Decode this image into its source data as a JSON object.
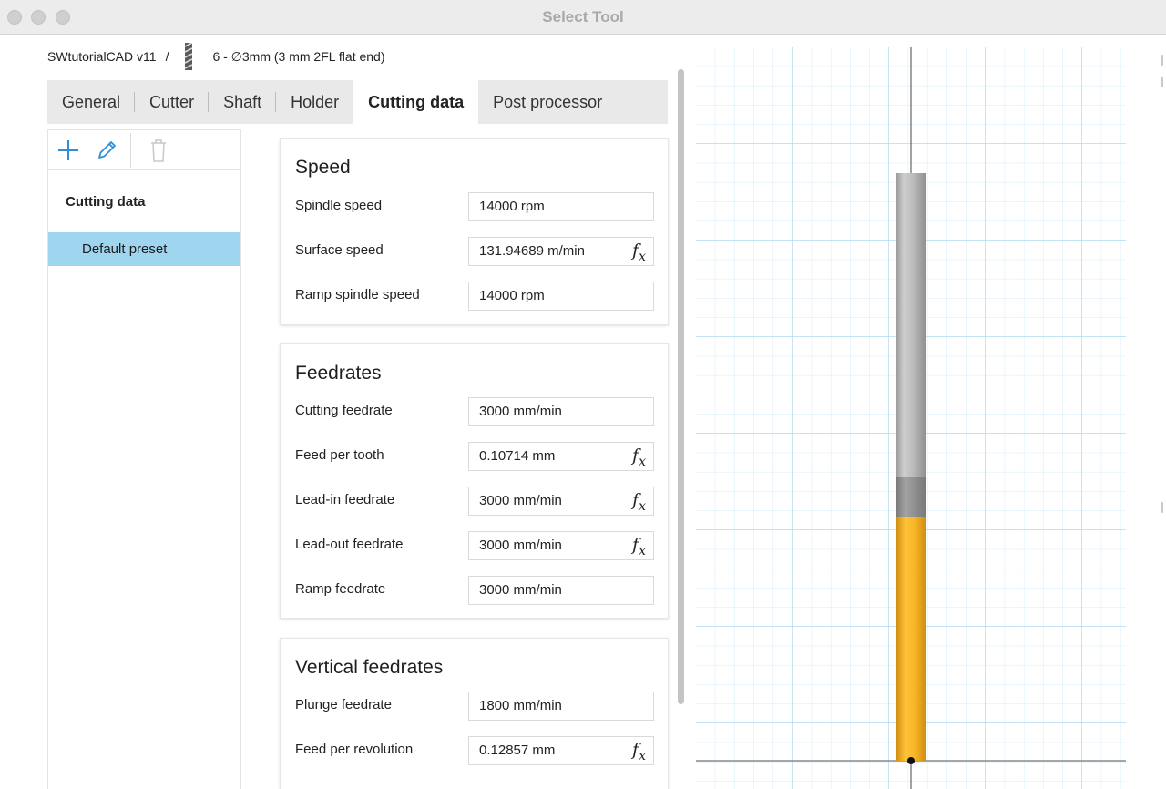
{
  "window": {
    "title": "Select Tool"
  },
  "breadcrumb": {
    "project": "SWtutorialCAD v11",
    "separator": "/",
    "tool": "6 - ∅3mm (3 mm 2FL flat end)"
  },
  "tabs": [
    "General",
    "Cutter",
    "Shaft",
    "Holder",
    "Cutting data",
    "Post processor"
  ],
  "active_tab": "Cutting data",
  "left_panel": {
    "tools": [
      "add-icon",
      "edit-icon",
      "trash-icon"
    ],
    "heading": "Cutting data",
    "items": [
      "Default preset"
    ]
  },
  "sections": {
    "speed": {
      "title": "Speed",
      "fields": [
        {
          "label": "Spindle speed",
          "value": "14000 rpm",
          "fx": false
        },
        {
          "label": "Surface speed",
          "value": "131.94689 m/min",
          "fx": true
        },
        {
          "label": "Ramp spindle speed",
          "value": "14000 rpm",
          "fx": false
        }
      ]
    },
    "feedrates": {
      "title": "Feedrates",
      "fields": [
        {
          "label": "Cutting feedrate",
          "value": "3000 mm/min",
          "fx": false
        },
        {
          "label": "Feed per tooth",
          "value": "0.10714 mm",
          "fx": true
        },
        {
          "label": "Lead-in feedrate",
          "value": "3000 mm/min",
          "fx": true
        },
        {
          "label": "Lead-out feedrate",
          "value": "3000 mm/min",
          "fx": true
        },
        {
          "label": "Ramp feedrate",
          "value": "3000 mm/min",
          "fx": false
        }
      ]
    },
    "vertical": {
      "title": "Vertical feedrates",
      "fields": [
        {
          "label": "Plunge feedrate",
          "value": "1800 mm/min",
          "fx": false
        },
        {
          "label": "Feed per revolution",
          "value": "0.12857 mm",
          "fx": true
        }
      ]
    }
  },
  "formula_symbol": {
    "f": "f",
    "x": "x"
  },
  "colors": {
    "flute": "#f5b324",
    "shank": "#b3b3b3",
    "grid_major": "#9fd3ee",
    "grid_minor": "#d6ecf8",
    "selection": "#9fd5ef"
  }
}
